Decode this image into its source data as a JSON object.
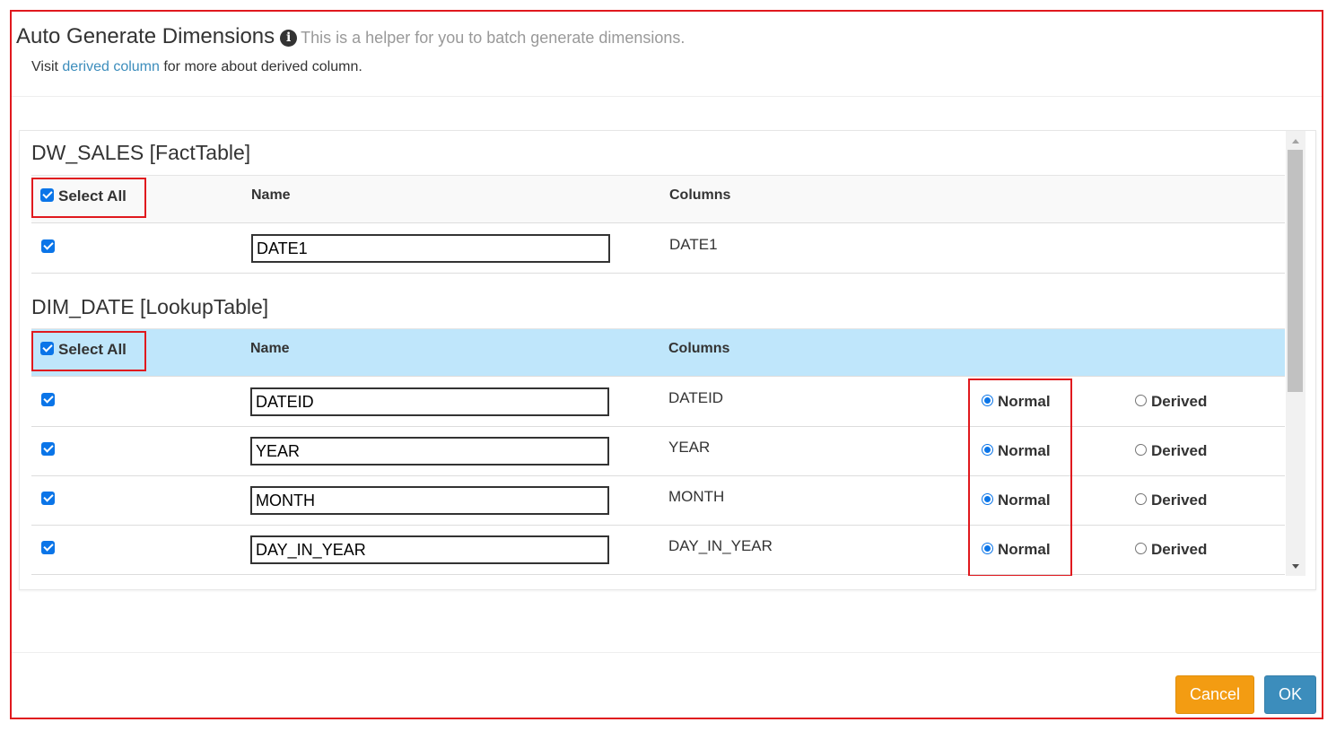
{
  "dialog": {
    "title": "Auto Generate Dimensions",
    "helper_text": "This is a helper for you to batch generate dimensions.",
    "visit_prefix": "Visit ",
    "visit_link": "derived column",
    "visit_suffix": " for more about derived column."
  },
  "fact_table": {
    "title": "DW_SALES [FactTable]",
    "select_all_label": "Select All",
    "select_all_checked": true,
    "header_name": "Name",
    "header_columns": "Columns",
    "rows": [
      {
        "checked": true,
        "name": "DATE1",
        "column": "DATE1"
      }
    ]
  },
  "lookup_table": {
    "title": "DIM_DATE [LookupTable]",
    "select_all_label": "Select All",
    "select_all_checked": true,
    "header_name": "Name",
    "header_columns": "Columns",
    "normal_label": "Normal",
    "derived_label": "Derived",
    "rows": [
      {
        "checked": true,
        "name": "DATEID",
        "column": "DATEID",
        "type": "Normal"
      },
      {
        "checked": true,
        "name": "YEAR",
        "column": "YEAR",
        "type": "Normal"
      },
      {
        "checked": true,
        "name": "MONTH",
        "column": "MONTH",
        "type": "Normal"
      },
      {
        "checked": true,
        "name": "DAY_IN_YEAR",
        "column": "DAY_IN_YEAR",
        "type": "Normal"
      }
    ]
  },
  "footer": {
    "cancel_label": "Cancel",
    "ok_label": "OK"
  },
  "colors": {
    "highlight_border": "#e0191e",
    "lookup_header_bg": "#bfe6fb",
    "link": "#3c8dbc",
    "cancel_bg": "#f39c12",
    "ok_bg": "#3c8dbc",
    "checkbox": "#0b75e8"
  }
}
